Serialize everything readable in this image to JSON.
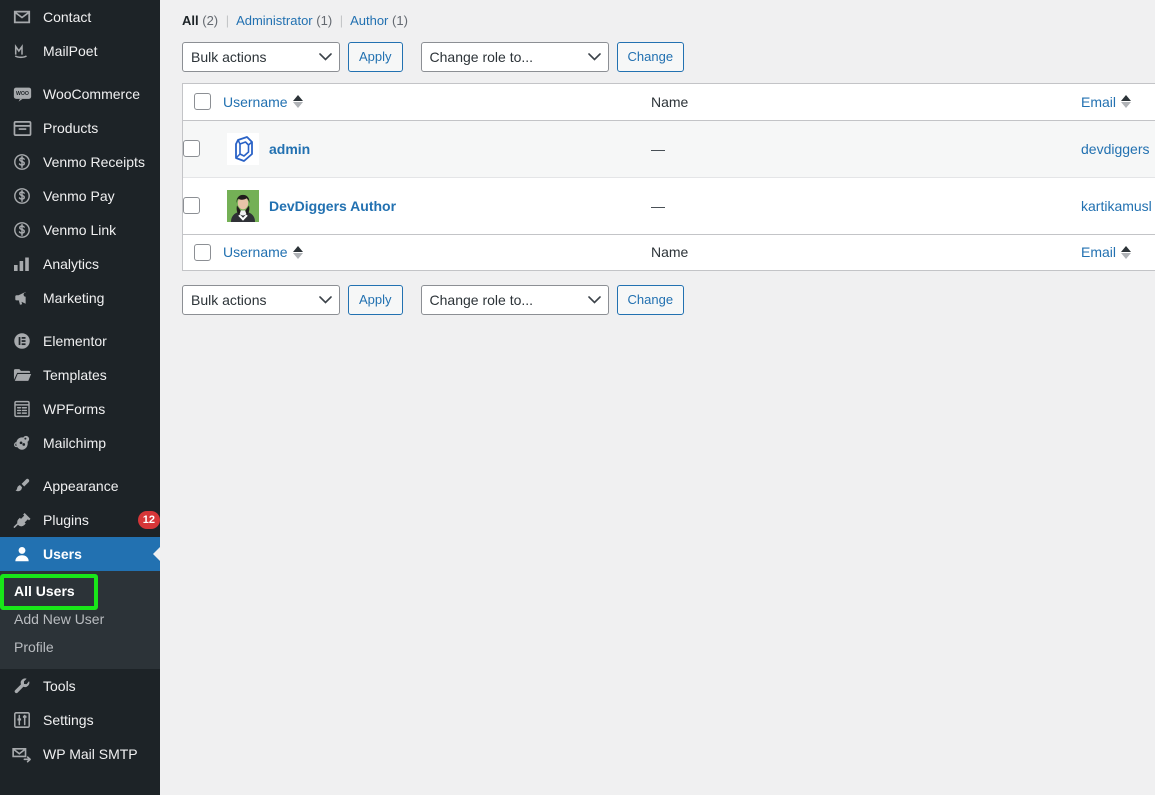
{
  "sidebar": {
    "items": [
      {
        "label": "Contact",
        "icon": "envelope-icon",
        "type": "item"
      },
      {
        "label": "MailPoet",
        "icon": "mailpoet-icon",
        "type": "item"
      },
      {
        "label": "",
        "icon": "",
        "type": "separator"
      },
      {
        "label": "WooCommerce",
        "icon": "woocommerce-icon",
        "type": "item"
      },
      {
        "label": "Products",
        "icon": "products-icon",
        "type": "item"
      },
      {
        "label": "Venmo Receipts",
        "icon": "dollar-icon",
        "type": "item"
      },
      {
        "label": "Venmo Pay",
        "icon": "dollar-icon",
        "type": "item"
      },
      {
        "label": "Venmo Link",
        "icon": "dollar-icon",
        "type": "item"
      },
      {
        "label": "Analytics",
        "icon": "chart-bars-icon",
        "type": "item"
      },
      {
        "label": "Marketing",
        "icon": "megaphone-icon",
        "type": "item"
      },
      {
        "label": "",
        "icon": "",
        "type": "separator"
      },
      {
        "label": "Elementor",
        "icon": "elementor-icon",
        "type": "item"
      },
      {
        "label": "Templates",
        "icon": "folder-icon",
        "type": "item"
      },
      {
        "label": "WPForms",
        "icon": "wpforms-icon",
        "type": "item"
      },
      {
        "label": "Mailchimp",
        "icon": "mailchimp-icon",
        "type": "item"
      },
      {
        "label": "",
        "icon": "",
        "type": "separator"
      },
      {
        "label": "Appearance",
        "icon": "paintbrush-icon",
        "type": "item"
      },
      {
        "label": "Plugins",
        "icon": "plug-icon",
        "type": "item",
        "badge": "12"
      },
      {
        "label": "Users",
        "icon": "user-icon",
        "type": "item",
        "active": true
      }
    ],
    "submenu": {
      "items": [
        {
          "label": "All Users",
          "current": true
        },
        {
          "label": "Add New User",
          "current": false
        },
        {
          "label": "Profile",
          "current": false
        }
      ]
    },
    "items_after": [
      {
        "label": "Tools",
        "icon": "wrench-icon",
        "type": "item"
      },
      {
        "label": "Settings",
        "icon": "sliders-icon",
        "type": "item"
      },
      {
        "label": "WP Mail SMTP",
        "icon": "mail-send-icon",
        "type": "item"
      }
    ],
    "highlight_color": "#19e619",
    "active_color": "#2271b1",
    "badge_color": "#d63638"
  },
  "filters": {
    "all_label": "All",
    "all_count": "(2)",
    "administrator_label": "Administrator",
    "administrator_count": "(1)",
    "author_label": "Author",
    "author_count": "(1)",
    "divider": "|"
  },
  "toolbar_top": {
    "bulk_value": "Bulk actions",
    "apply_label": "Apply",
    "role_value": "Change role to...",
    "change_label": "Change"
  },
  "toolbar_bottom": {
    "bulk_value": "Bulk actions",
    "apply_label": "Apply",
    "role_value": "Change role to...",
    "change_label": "Change"
  },
  "table": {
    "columns": {
      "username": "Username",
      "name": "Name",
      "email": "Email"
    },
    "rows": [
      {
        "username": "admin",
        "name": "—",
        "email": "devdiggers",
        "avatar": "devdiggers-logo-avatar"
      },
      {
        "username": "DevDiggers Author",
        "name": "—",
        "email": "kartikamusl",
        "avatar": "woman-photo-avatar"
      }
    ]
  }
}
